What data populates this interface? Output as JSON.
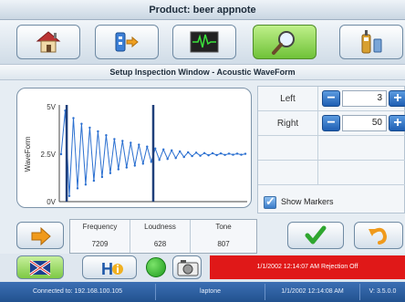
{
  "header": {
    "title": "Product: beer appnote"
  },
  "nav": {
    "buttons": [
      {
        "name": "home"
      },
      {
        "name": "io"
      },
      {
        "name": "waveform"
      },
      {
        "name": "inspect",
        "active": true
      },
      {
        "name": "device"
      }
    ]
  },
  "section": {
    "title": "Setup Inspection Window - Acoustic WaveForm"
  },
  "chart": {
    "ylabel": "WaveForm",
    "yticks": [
      "5V",
      "2.5V",
      "0V"
    ]
  },
  "chart_data": {
    "type": "line",
    "ylabel": "WaveForm",
    "ytick_labels": [
      "5V",
      "2.5V",
      "0V"
    ],
    "ylim": [
      0,
      5
    ],
    "series": [
      {
        "values": [
          2.5,
          4.8,
          0.3,
          4.4,
          0.7,
          4.1,
          0.9,
          3.9,
          1.1,
          3.7,
          1.3,
          3.5,
          1.5,
          3.3,
          1.7,
          3.2,
          1.8,
          3.1,
          1.9,
          3.0,
          2.0,
          2.9,
          2.1,
          2.8,
          2.2,
          2.75,
          2.25,
          2.7,
          2.3,
          2.65,
          2.35,
          2.6,
          2.4,
          2.58,
          2.42,
          2.56,
          2.44,
          2.55,
          2.45,
          2.54,
          2.46,
          2.53,
          2.47,
          2.53,
          2.47,
          2.52
        ]
      }
    ],
    "markers": [
      {
        "name": "Left",
        "value": 3
      },
      {
        "name": "Right",
        "value": 50
      }
    ]
  },
  "controls": {
    "left": {
      "label": "Left",
      "value": "3"
    },
    "right": {
      "label": "Right",
      "value": "50"
    },
    "show_markers": {
      "label": "Show Markers",
      "checked": true
    }
  },
  "metrics": {
    "headers": [
      "Frequency",
      "Loudness",
      "Tone"
    ],
    "values": [
      "7209",
      "628",
      "807"
    ]
  },
  "alarm": {
    "text": "1/1/2002 12:14:07 AM Rejection Off"
  },
  "status": {
    "connection": "Connected to: 192.168.100.105",
    "host": "laptone",
    "time": "1/1/2002 12:14:08 AM",
    "version": "V: 3.5.0.0"
  },
  "colors": {
    "accent": "#2a6fd0",
    "active_nav": "#7dc944",
    "alarm": "#e01818",
    "status_bar": "#22528f"
  }
}
